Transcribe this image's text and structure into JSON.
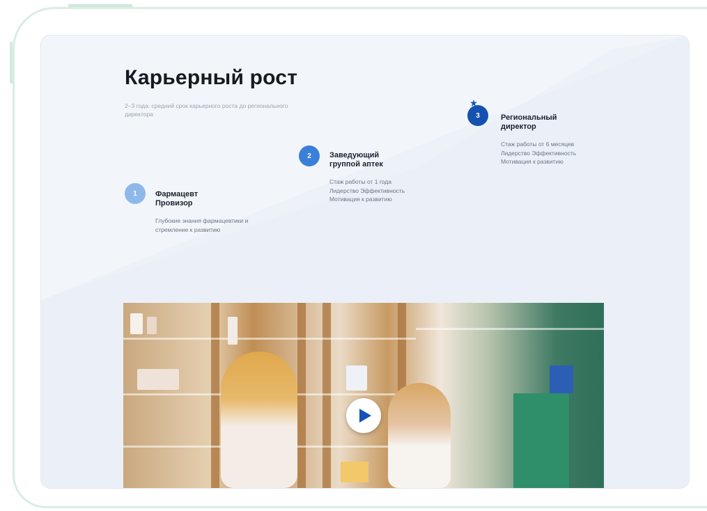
{
  "section": {
    "title": "Карьерный рост",
    "subtitle": "2–3 года: средний срок карьерного роста до регионального директора"
  },
  "steps": [
    {
      "number": "1",
      "title": "Фармацевт Провизор",
      "desc": "Глубокие знания фармацевтики и стремление к развитию",
      "color": "#8fb8ea"
    },
    {
      "number": "2",
      "title": "Заведующий группой аптек",
      "desc": "Стаж работы от 1 года Лидерство Эффективность Мотивация к развитию",
      "color": "#3a80da"
    },
    {
      "number": "3",
      "title": "Региональный директор",
      "desc": "Стаж работы от 6 месяцев Лидерство Эффективность Мотивация к развитию",
      "color": "#1552b0"
    }
  ],
  "video": {
    "play_icon": "play-icon",
    "accent": "#1552b8"
  },
  "colors": {
    "card_bg": "#f2f6fb",
    "title": "#161a22",
    "frame": "#d9ede3"
  }
}
